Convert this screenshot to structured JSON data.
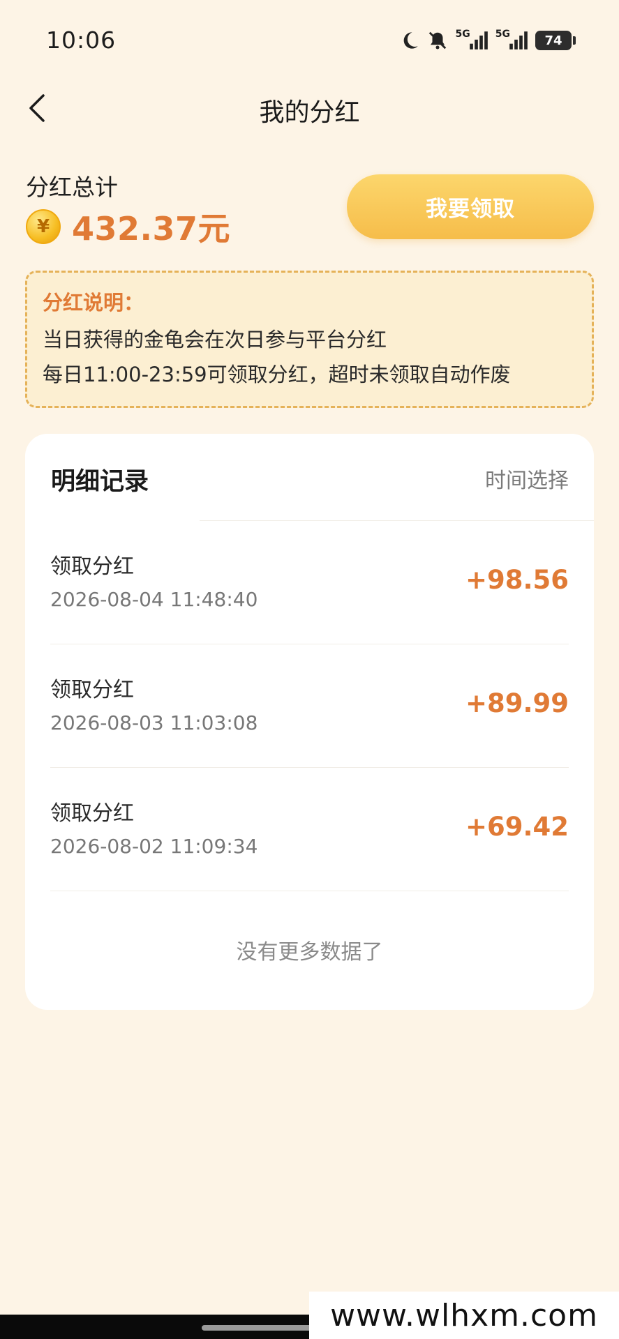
{
  "status_bar": {
    "time": "10:06",
    "net1": "5G",
    "net2": "5G",
    "battery": "74",
    "icons": [
      "moon-icon",
      "bell-muted-icon",
      "signal-icon",
      "signal-icon"
    ]
  },
  "header": {
    "title": "我的分红",
    "back_icon": "chevron-left-icon"
  },
  "summary": {
    "label": "分红总计",
    "coin_symbol": "¥",
    "amount": "432.37元",
    "claim_label": "我要领取"
  },
  "notice": {
    "title": "分红说明：",
    "lines": [
      "当日获得的金龟会在次日参与平台分红",
      "每日11:00-23:59可领取分红，超时未领取自动作废"
    ]
  },
  "records": {
    "title": "明细记录",
    "filter_label": "时间选择",
    "items": [
      {
        "title": "领取分红",
        "time": "2026-08-04 11:48:40",
        "amount": "+98.56"
      },
      {
        "title": "领取分红",
        "time": "2026-08-03 11:03:08",
        "amount": "+89.99"
      },
      {
        "title": "领取分红",
        "time": "2026-08-02 11:09:34",
        "amount": "+69.42"
      }
    ],
    "no_more": "没有更多数据了"
  },
  "watermark": "www.wlhxm.com",
  "colors": {
    "background": "#fdf4e6",
    "accent": "#e07a35",
    "button": "#f6bd4a",
    "notice_border": "#e5b259"
  }
}
